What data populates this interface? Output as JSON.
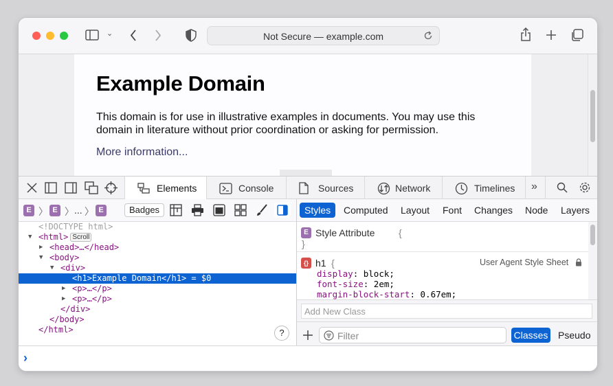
{
  "browser": {
    "url_text": "Not Secure — example.com",
    "traffic_colors": {
      "close": "#fe5f57",
      "minimize": "#febc2e",
      "zoom": "#28c840"
    }
  },
  "page": {
    "heading": "Example Domain",
    "paragraph": "This domain is for use in illustrative examples in documents. You may use this domain in literature without prior coordination or asking for permission.",
    "link": "More information..."
  },
  "devtools": {
    "tabs": [
      {
        "label": "Elements",
        "icon": "elements-icon"
      },
      {
        "label": "Console",
        "icon": "console-icon"
      },
      {
        "label": "Sources",
        "icon": "sources-icon"
      },
      {
        "label": "Network",
        "icon": "network-icon"
      },
      {
        "label": "Timelines",
        "icon": "timelines-icon"
      }
    ],
    "active_tab": "Elements",
    "elements": {
      "breadcrumb": [
        "E",
        "E",
        "...",
        "E"
      ],
      "badges_label": "Badges",
      "dom": {
        "doctype": "<!DOCTYPE html>",
        "html": "<html>",
        "scroll_badge": "Scroll",
        "head": "<head>…</head>",
        "body": "<body>",
        "div": "<div>",
        "h1": "<h1>Example Domain</h1>",
        "h1_suffix": " = $0",
        "p1": "<p>…</p>",
        "p2": "<p>…</p>",
        "div_close": "</div>",
        "body_close": "</body>",
        "html_close": "</html>"
      },
      "help_label": "?"
    },
    "styles": {
      "tabs": [
        "Styles",
        "Computed",
        "Layout",
        "Font",
        "Changes",
        "Node",
        "Layers"
      ],
      "active": "Styles",
      "style_attribute": {
        "badge": "E",
        "label": "Style Attribute",
        "open": "{",
        "close": "}"
      },
      "h1_rule": {
        "badge": "{}",
        "selector": "h1",
        "open": "{",
        "source": "User Agent Style Sheet",
        "declarations": [
          {
            "prop": "display",
            "value": "block;"
          },
          {
            "prop": "font-size",
            "value": "2em;"
          },
          {
            "prop": "margin-block-start",
            "value": "0.67em;"
          }
        ]
      },
      "add_class_placeholder": "Add New Class",
      "filter_placeholder": "Filter",
      "classes_label": "Classes",
      "pseudo_label": "Pseudo"
    },
    "console_prompt": "›",
    "accent_color": "#0e63d3",
    "tag_color": "#881280"
  }
}
